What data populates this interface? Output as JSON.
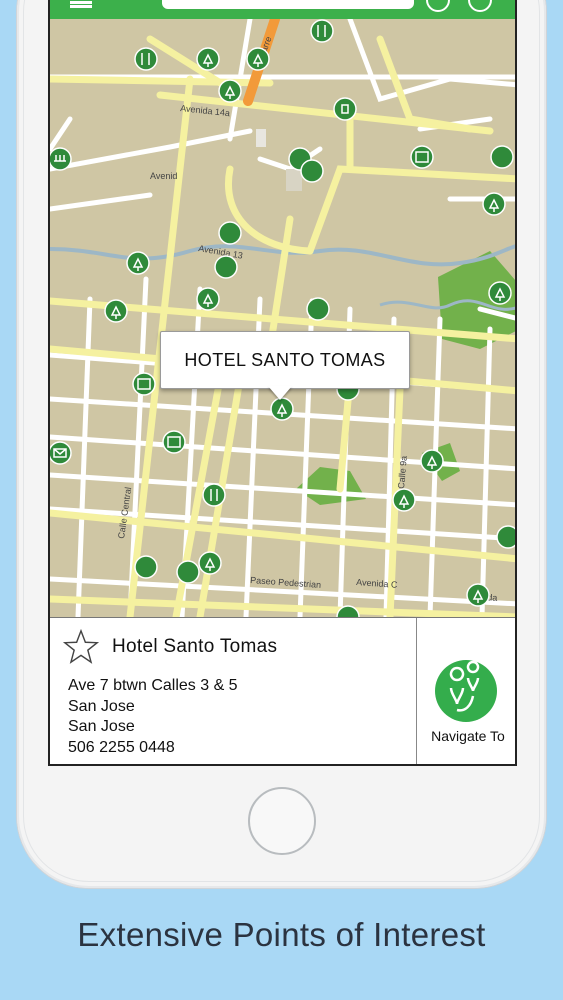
{
  "map": {
    "callout_title": "HOTEL SANTO TOMAS",
    "streets": [
      "Avenida 14a",
      "Avenida 13",
      "Avenid",
      "Calle Central",
      "Calle 9a",
      "Carre",
      "Avenida C",
      "Paseo Pedestrian",
      "Tunida"
    ]
  },
  "place": {
    "name": "Hotel Santo Tomas",
    "address_line1": "Ave 7 btwn Calles 3 & 5",
    "city": "San Jose",
    "region": "San Jose",
    "phone": "506 2255 0448"
  },
  "nav": {
    "label": "Navigate To"
  },
  "caption": "Extensive Points of Interest",
  "colors": {
    "accent": "#3cb04b",
    "background": "#a9d8f5",
    "map_land": "#cfc6a4",
    "road": "#f5f1a0",
    "poi": "#2f8a3a"
  },
  "icons": [
    "menu-icon",
    "star-icon",
    "navigate-to-icon",
    "poi-tree-icon",
    "poi-cutlery-icon",
    "poi-shopping-icon",
    "poi-money-icon",
    "poi-museum-icon",
    "poi-mail-icon",
    "poi-building-icon"
  ]
}
